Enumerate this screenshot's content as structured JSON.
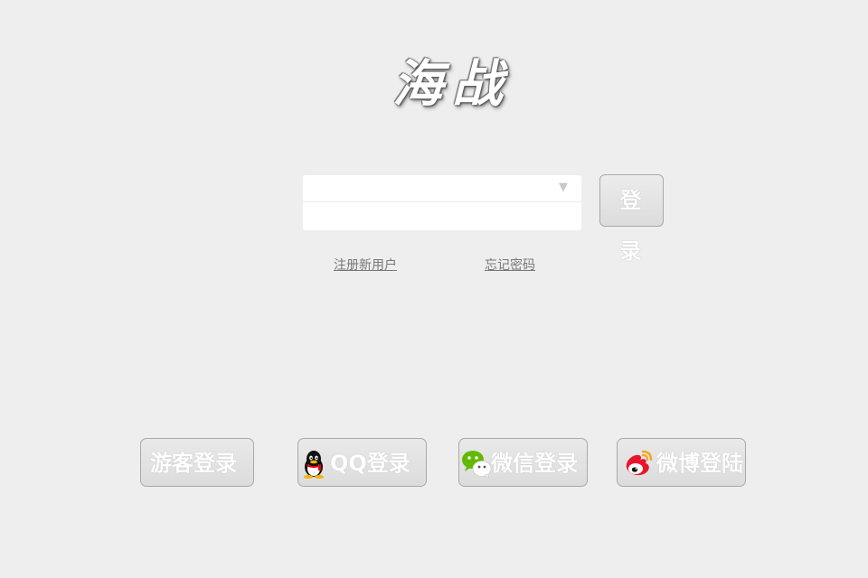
{
  "app": {
    "logo_text": "海战"
  },
  "login_form": {
    "account_value": "",
    "password_value": "",
    "dropdown_symbol": "▼",
    "login_label": "登 录"
  },
  "links": {
    "register": "注册新用户",
    "forgot_password": "忘记密码"
  },
  "social_login": {
    "guest": "游客登录",
    "qq": "QQ登录",
    "wechat": "微信登录",
    "weibo": "微博登陆"
  },
  "icons": {
    "qq": "qq-penguin-icon",
    "wechat": "wechat-icon",
    "weibo": "weibo-icon"
  },
  "colors": {
    "background": "#eeeeee",
    "button_face": "#dcdcdc",
    "link": "#777777",
    "wechat_green": "#62b900",
    "weibo_red": "#e6162d",
    "weibo_orange": "#f5a623"
  }
}
